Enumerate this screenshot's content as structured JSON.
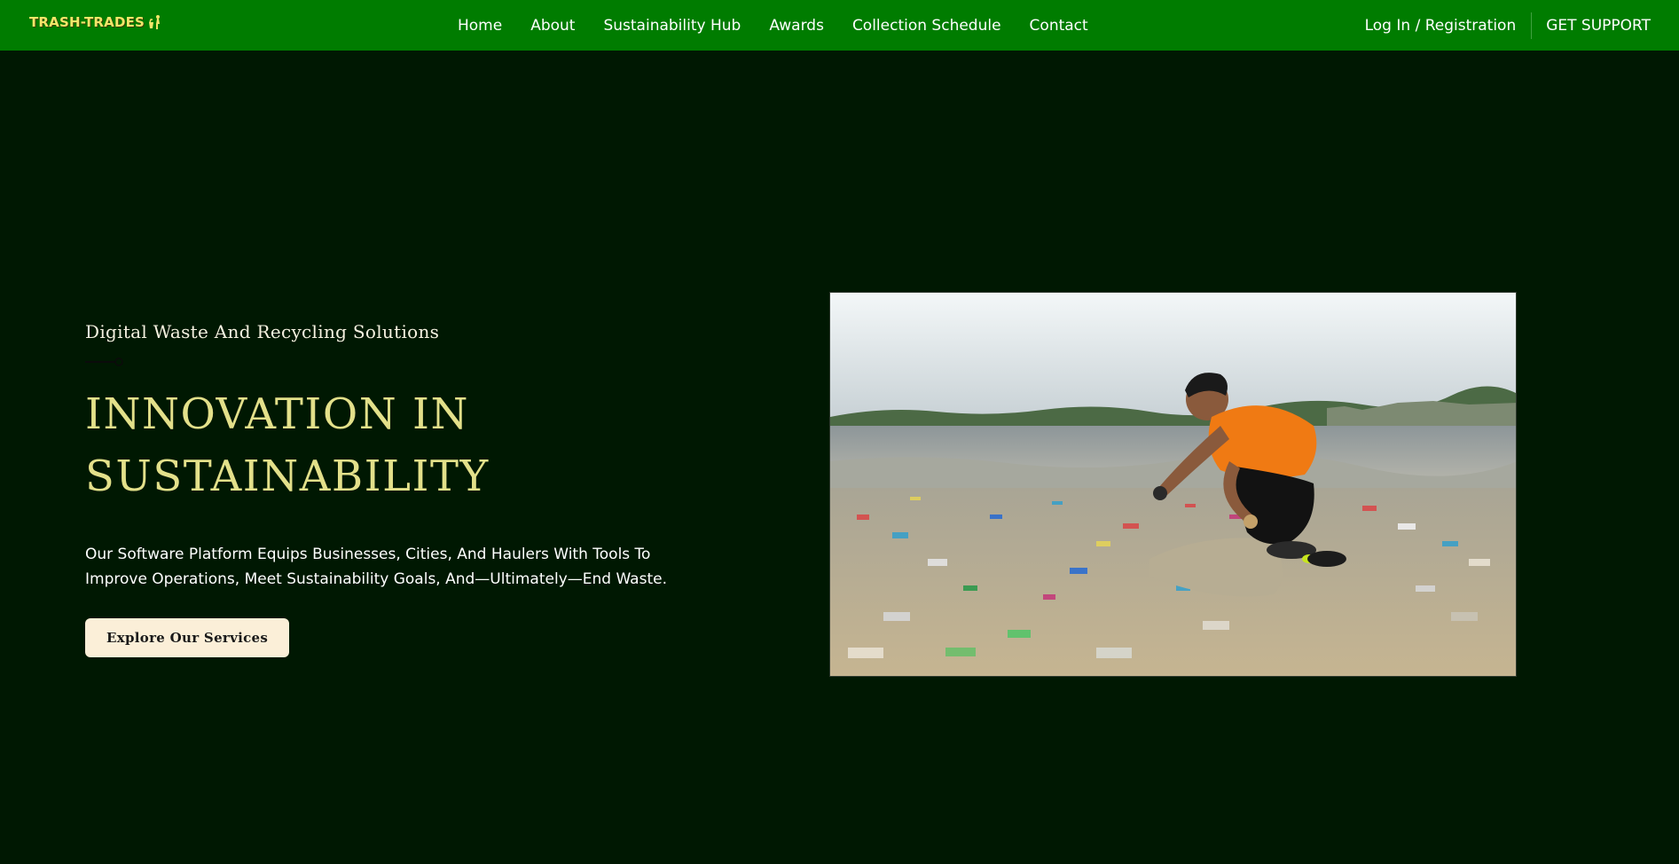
{
  "navbar": {
    "brand": "TRASH-TRADES",
    "links": [
      "Home",
      "About",
      "Sustainability Hub",
      "Awards",
      "Collection Schedule",
      "Contact"
    ],
    "login": "Log In / Registration",
    "support": "GET SUPPORT",
    "bg_color": "#007c00",
    "brand_color": "#f2e66a"
  },
  "hero": {
    "eyebrow": "Digital Waste And Recycling Solutions",
    "title_line1": "INNOVATION IN",
    "title_line2": "SUSTAINABILITY",
    "description_line1": "Our Software Platform Equips Businesses, Cities, And Haulers With Tools To",
    "description_line2": "Improve Operations, Meet Sustainability Goals, And—Ultimately—End Waste.",
    "cta": "Explore Our Services",
    "title_color": "#e3e08a",
    "bg_color": "#001802",
    "image_icon": "beach-cleanup-photo"
  }
}
